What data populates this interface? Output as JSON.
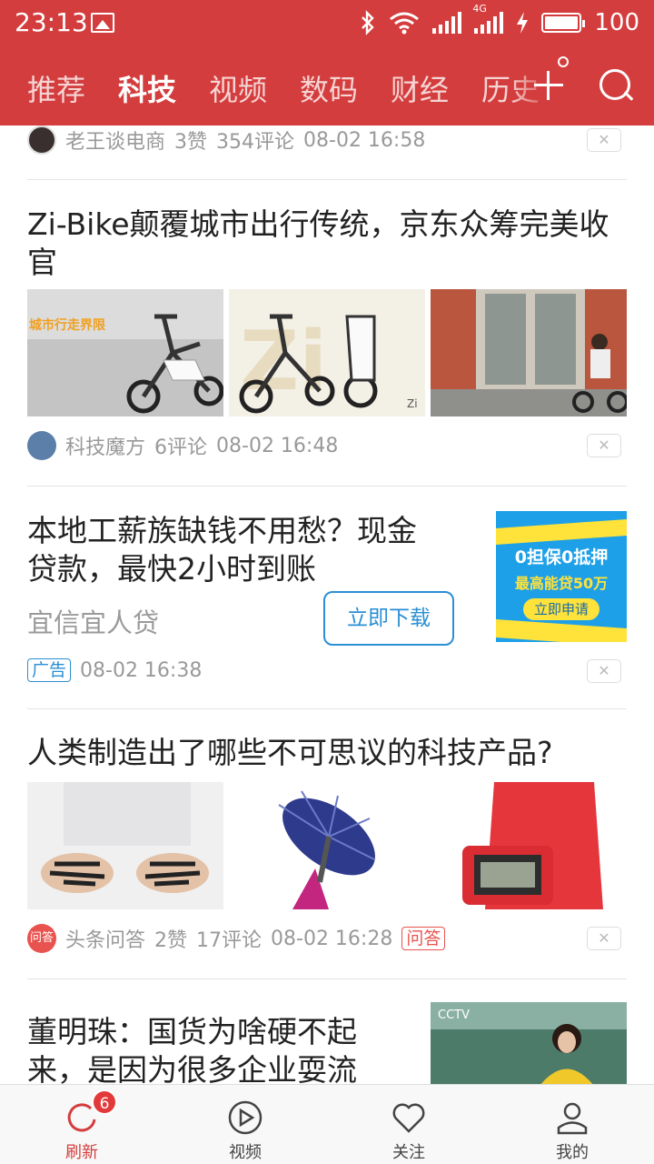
{
  "status_bar": {
    "time": "23:13",
    "network_label": "4G",
    "battery": "100",
    "battery_level": 1.0
  },
  "nav": {
    "tabs": [
      {
        "label": "推荐",
        "active": false
      },
      {
        "label": "科技",
        "active": true
      },
      {
        "label": "视频",
        "active": false
      },
      {
        "label": "数码",
        "active": false
      },
      {
        "label": "财经",
        "active": false
      },
      {
        "label": "历史",
        "active": false
      }
    ],
    "plus_icon": "plus-icon",
    "search_icon": "search-icon"
  },
  "feed": {
    "item0": {
      "source": "老王谈电商",
      "likes": "3赞",
      "comments": "354评论",
      "time": "08-02 16:58",
      "close": "✕"
    },
    "item1": {
      "title": "Zi-Bike颠覆城市出行传统，京东众筹完美收官",
      "image1_caption": "城市行走界限",
      "image2_logo": "Zi",
      "image2_mark": "Zi",
      "source": "科技魔方",
      "comments": "6评论",
      "time": "08-02 16:48",
      "close": "✕"
    },
    "ad": {
      "title": "本地工薪族缺钱不用愁？现金贷款，最快2小时到账",
      "advertiser": "宜信宜人贷",
      "cta": "立即下载",
      "banner_line1": "0担保0抵押",
      "banner_line2": "最高能贷50万",
      "banner_button": "立即申请",
      "tag": "广告",
      "time": "08-02 16:38",
      "close": "✕"
    },
    "item3": {
      "title": "人类制造出了哪些不可思议的科技产品?",
      "avatar_text": "问答",
      "source": "头条问答",
      "likes": "2赞",
      "comments": "17评论",
      "time": "08-02 16:28",
      "tag": "问答",
      "close": "✕"
    },
    "item4": {
      "title": "董明珠：国货为啥硬不起来，是因为很多企业耍流",
      "video_logo": "CCTV"
    }
  },
  "bottom_bar": {
    "items": [
      {
        "label": "刷新",
        "icon": "refresh-icon",
        "active": true
      },
      {
        "label": "视频",
        "icon": "play-icon",
        "active": false
      },
      {
        "label": "关注",
        "icon": "heart-icon",
        "active": false
      },
      {
        "label": "我的",
        "icon": "person-icon",
        "active": false
      }
    ],
    "badge": "6"
  },
  "colors": {
    "brand_red": "#d43d3d",
    "ad_blue": "#2a8fd4",
    "ad_banner_bg": "#1ea0e8",
    "ad_banner_yellow": "#ffe23a",
    "qa_red": "#e9534f",
    "meta_gray": "#999999"
  }
}
